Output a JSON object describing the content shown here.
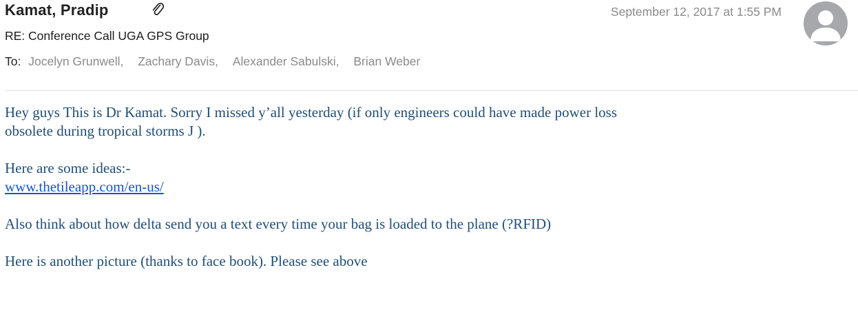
{
  "header": {
    "sender": "Kamat, Pradip",
    "date": "September 12, 2017 at 1:55 PM",
    "subject": "RE: Conference Call UGA GPS Group",
    "to_label": "To:",
    "recipients": [
      "Jocelyn Grunwell,",
      "Zachary Davis,",
      "Alexander Sabulski,",
      "Brian Weber"
    ],
    "attachment_icon": "paperclip-icon",
    "avatar_icon": "person-silhouette-icon"
  },
  "body": {
    "line1": "Hey guys This is Dr Kamat. Sorry I missed y’all yesterday (if only engineers could have made power loss",
    "line2": "obsolete during tropical storms J ).",
    "ideas_intro": "Here are some ideas:-",
    "link": "www.thetileapp.com/en-us/",
    "delta": "Also think about how delta send you a text every time your bag is loaded to the plane (?RFID)",
    "picture": "Here is another picture (thanks to face book). Please see above"
  },
  "colors": {
    "body_text": "#1f4e79",
    "link": "#1155cc",
    "meta_gray": "#8a8a8a",
    "avatar_bg": "#a7a8ac"
  }
}
